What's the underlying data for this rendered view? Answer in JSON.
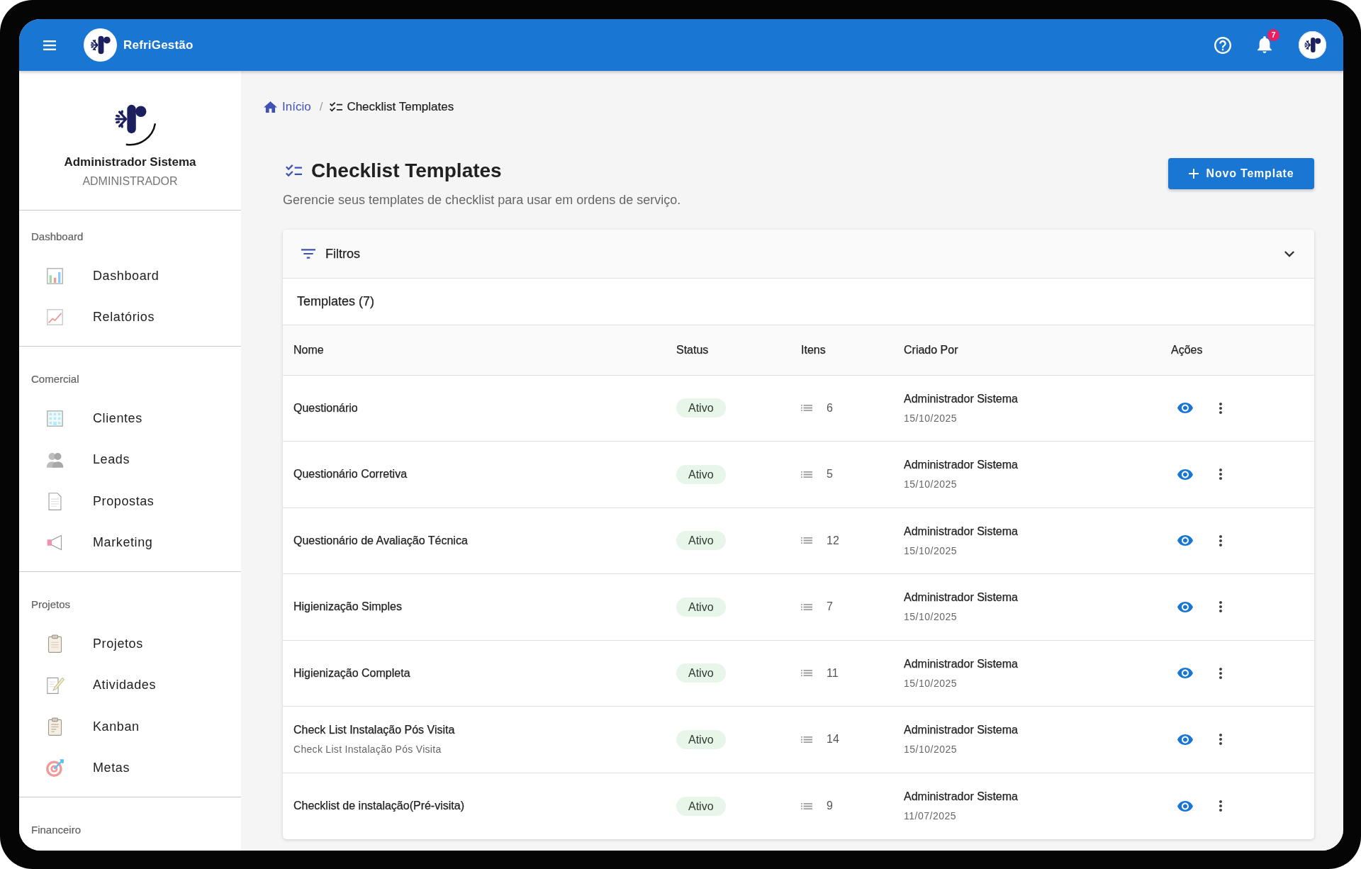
{
  "topbar": {
    "brand": "RefriGestão",
    "notification_count": "7"
  },
  "sidebar": {
    "user": {
      "name": "Administrador Sistema",
      "role": "ADMINISTRADOR"
    },
    "sections": [
      {
        "title": "Dashboard",
        "items": [
          {
            "label": "Dashboard",
            "selected": false
          },
          {
            "label": "Relatórios",
            "selected": false
          }
        ]
      },
      {
        "title": "Comercial",
        "items": [
          {
            "label": "Clientes",
            "selected": false
          },
          {
            "label": "Leads",
            "selected": false
          },
          {
            "label": "Propostas",
            "selected": false
          },
          {
            "label": "Marketing",
            "selected": false
          }
        ]
      },
      {
        "title": "Projetos",
        "items": [
          {
            "label": "Projetos",
            "selected": false
          },
          {
            "label": "Atividades",
            "selected": false
          },
          {
            "label": "Kanban",
            "selected": false
          },
          {
            "label": "Metas",
            "selected": false
          }
        ]
      },
      {
        "title": "Financeiro"
      }
    ]
  },
  "breadcrumb": {
    "separator": "/",
    "items": [
      {
        "label": "Início",
        "kind": "link"
      },
      {
        "label": "Checklist Templates",
        "kind": "current"
      }
    ]
  },
  "page_header": {
    "title": "Checklist Templates",
    "subtitle": "Gerencie seus templates de checklist para usar em ordens de serviço.",
    "action_button": "Novo Template"
  },
  "filters": {
    "title": "Filtros",
    "expanded": false
  },
  "templates": {
    "title": "Templates (7)",
    "columns": [
      "Nome",
      "Status",
      "Itens",
      "Criado Por",
      "Ações"
    ],
    "rows": [
      {
        "name": "Questionário",
        "status": "Ativo",
        "items": "6",
        "created_by": "Administrador Sistema",
        "created_at": "15/10/2025"
      },
      {
        "name": "Questionário Corretiva",
        "status": "Ativo",
        "items": "5",
        "created_by": "Administrador Sistema",
        "created_at": "15/10/2025"
      },
      {
        "name": "Questionário de Avaliação Técnica",
        "status": "Ativo",
        "items": "12",
        "created_by": "Administrador Sistema",
        "created_at": "15/10/2025"
      },
      {
        "name": "Higienização Simples",
        "status": "Ativo",
        "items": "7",
        "created_by": "Administrador Sistema",
        "created_at": "15/10/2025"
      },
      {
        "name": "Higienização Completa",
        "status": "Ativo",
        "items": "11",
        "created_by": "Administrador Sistema",
        "created_at": "15/10/2025"
      },
      {
        "name": "Check List Instalação Pós Visita",
        "description": "Check List Instalação Pós Visita",
        "status": "Ativo",
        "items": "14",
        "created_by": "Administrador Sistema",
        "created_at": "15/10/2025"
      },
      {
        "name": "Checklist de instalação(Pré-visita)",
        "status": "Ativo",
        "items": "9",
        "created_by": "Administrador Sistema",
        "created_at": "11/07/2025"
      }
    ]
  }
}
